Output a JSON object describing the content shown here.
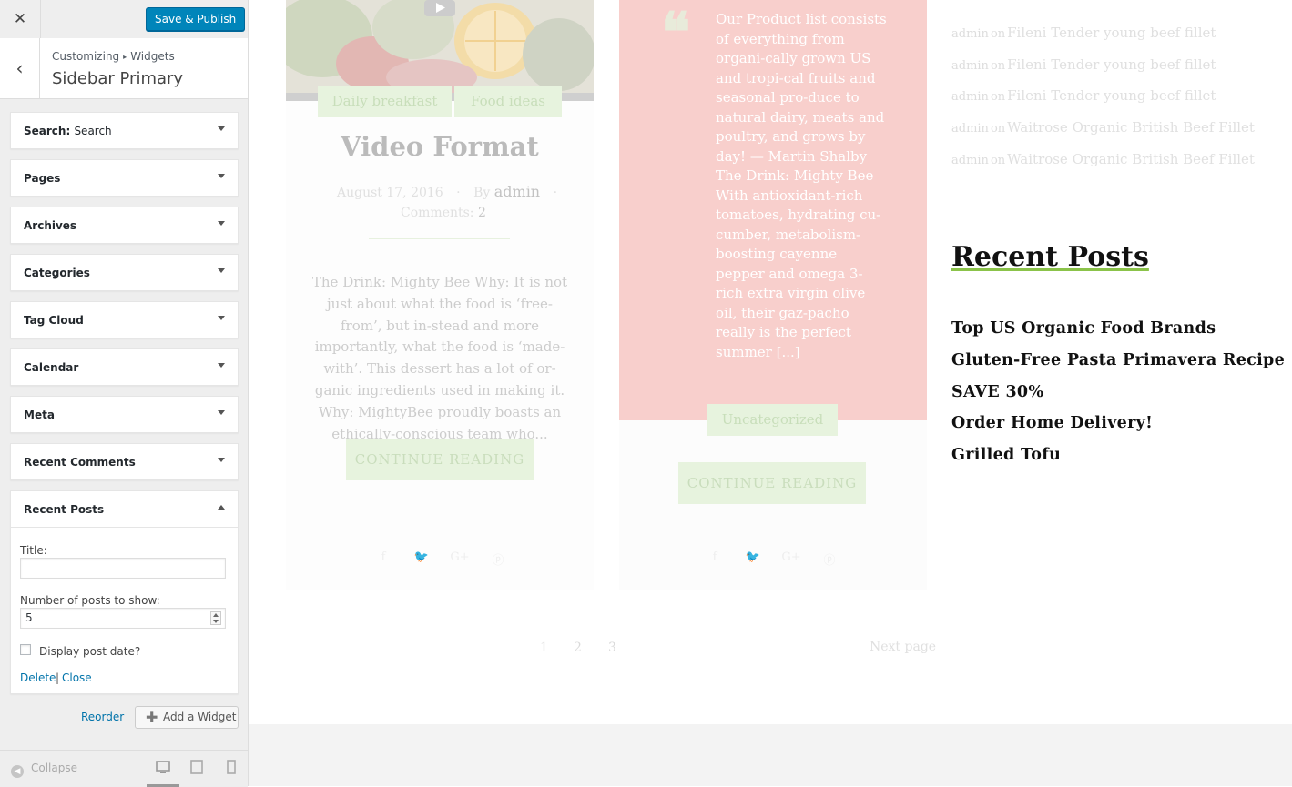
{
  "customizer": {
    "close_symbol": "✕",
    "publish_label": "Save & Publish",
    "back_symbol": "‹",
    "breadcrumb": {
      "root": "Customizing",
      "separator": "▸",
      "parent": "Widgets"
    },
    "section_title": "Sidebar Primary",
    "widgets": [
      {
        "title": "Search",
        "subtitle": "Search"
      },
      {
        "title": "Pages"
      },
      {
        "title": "Archives"
      },
      {
        "title": "Categories"
      },
      {
        "title": "Tag Cloud"
      },
      {
        "title": "Calendar"
      },
      {
        "title": "Meta"
      },
      {
        "title": "Recent Comments"
      }
    ],
    "open_widget": {
      "title": "Recent Posts",
      "title_label": "Title:",
      "title_value": "",
      "number_label": "Number of posts to show:",
      "number_value": "5",
      "date_label": "Display post date?",
      "date_checked": false,
      "delete_label": "Delete",
      "separator": "|",
      "close_label": "Close"
    },
    "reorder_label": "Reorder",
    "add_widget_label": "Add a Widget",
    "collapse_label": "Collapse",
    "device_buttons": [
      "desktop-icon",
      "tablet-icon",
      "mobile-icon"
    ],
    "active_device": "desktop",
    "accent_color": "#0085ba"
  },
  "preview": {
    "post1": {
      "categories": [
        "Daily breakfast",
        "Food ideas"
      ],
      "title": "Video Format",
      "date": "August 17, 2016",
      "by_label": "By",
      "author": "admin",
      "comments_label": "Comments:",
      "comments_count": "2",
      "excerpt": "The Drink: Mighty Bee Why: It is not just about what the food is ‘free-from’, but in-stead and more importantly, what the food is ‘made-with’. This dessert has a lot of or-ganic ingredients used in making it. Why: MightyBee proudly boasts an ethically-conscious team who...",
      "more_label": "CONTINUE READING",
      "share_icons": [
        "facebook-icon",
        "twitter-icon",
        "google-plus-icon",
        "pinterest-icon"
      ]
    },
    "post2": {
      "quote_mark": "❝",
      "quote_text": "Our Product list consists of everything from organi-cally grown US and tropi-cal fruits and seasonal pro-duce to natural dairy, meats and poultry, and grows by day! — Martin Shalby The Drink: Mighty Bee With antioxidant-rich tomatoes, hydrating cu-cumber, metabolism-boosting cayenne pepper and omega 3-rich extra virgin olive oil, their gaz-pacho really is the perfect summer [...]",
      "category": "Uncategorized",
      "more_label": "CONTINUE READING",
      "share_icons": [
        "facebook-icon",
        "twitter-icon",
        "google-plus-icon",
        "pinterest-icon"
      ],
      "quote_bg": "#f8cfcc"
    },
    "pagination": {
      "pages": [
        "1",
        "2",
        "3"
      ],
      "next_label": "Next page"
    },
    "sidebar": {
      "recent_comments": [
        {
          "author": "admin",
          "on": "on",
          "post": "Fileni Tender young beef fillet"
        },
        {
          "author": "admin",
          "on": "on",
          "post": "Fileni Tender young beef fillet"
        },
        {
          "author": "admin",
          "on": "on",
          "post": "Fileni Tender young beef fillet"
        },
        {
          "author": "admin",
          "on": "on",
          "post": "Waitrose Organic British Beef Fillet"
        },
        {
          "author": "admin",
          "on": "on",
          "post": "Waitrose Organic British Beef Fillet"
        }
      ],
      "recent_posts_heading": "Recent Posts",
      "recent_posts": [
        "Top US Organic Food Brands",
        "Gluten-Free Pasta Primavera Recipe",
        "SAVE 30%",
        "Order Home Delivery!",
        "Grilled Tofu"
      ],
      "accent_color": "#8bc34a"
    }
  }
}
